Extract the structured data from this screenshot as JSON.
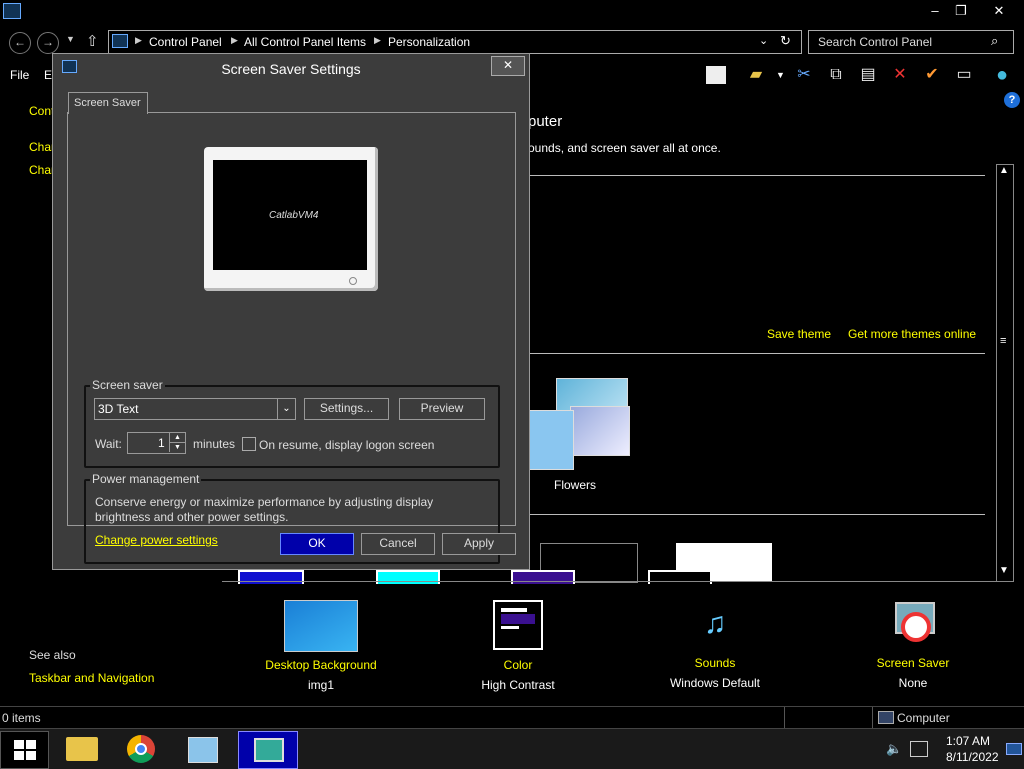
{
  "titlebar": {
    "minimize": "–",
    "restore": "❐",
    "close": "✕"
  },
  "address": {
    "crumbs": [
      "Control Panel",
      "All Control Panel Items",
      "Personalization"
    ],
    "search_placeholder": "Search Control Panel"
  },
  "menu": {
    "file": "File",
    "edit": "E"
  },
  "sidebar": {
    "home": "Cont",
    "links": [
      "Char",
      "Char"
    ],
    "see_also": "See also",
    "taskbar_link": "Taskbar and Navigation"
  },
  "content": {
    "heading_fragment": "puter",
    "desc_fragment": "ounds, and screen saver all at once.",
    "save_theme": "Save theme",
    "get_more": "Get more themes online",
    "flowers": "Flowers"
  },
  "dialog": {
    "title": "Screen Saver Settings",
    "close": "✕",
    "tab": "Screen Saver",
    "preview_text": "CatlabVM4",
    "screensaver_group": "Screen saver",
    "screensaver_value": "3D Text",
    "settings_btn": "Settings...",
    "preview_btn": "Preview",
    "wait_label": "Wait:",
    "wait_value": "1",
    "minutes_label": "minutes",
    "resume_label": "On resume, display logon screen",
    "power_group": "Power management",
    "power_desc1": "Conserve energy or maximize performance by adjusting display",
    "power_desc2": "brightness and other power settings.",
    "power_link": "Change power settings",
    "ok": "OK",
    "cancel": "Cancel",
    "apply": "Apply"
  },
  "bottom_items": [
    {
      "title": "Desktop Background",
      "sub": "img1"
    },
    {
      "title": "Color",
      "sub": "High Contrast"
    },
    {
      "title": "Sounds",
      "sub": "Windows Default"
    },
    {
      "title": "Screen Saver",
      "sub": "None"
    }
  ],
  "status": {
    "items": "0 items",
    "location": "Computer"
  },
  "clock": {
    "time": "1:07 AM",
    "date": "8/11/2022"
  },
  "colors": {
    "link": "#ffff00",
    "ok_button": "#0000aa",
    "panel": "#3c3c3c"
  }
}
